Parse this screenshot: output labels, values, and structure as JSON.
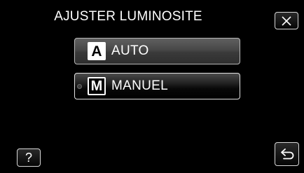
{
  "header": {
    "title": "AJUSTER LUMINOSITE"
  },
  "options": [
    {
      "icon": "A",
      "label": "AUTO",
      "selected": false
    },
    {
      "icon": "M",
      "label": "MANUEL",
      "selected": true
    }
  ],
  "buttons": {
    "close_icon": "close-icon",
    "help_label": "?",
    "back_icon": "return-arrow-icon"
  },
  "colors": {
    "background": "#000000",
    "text": "#ffffff"
  }
}
